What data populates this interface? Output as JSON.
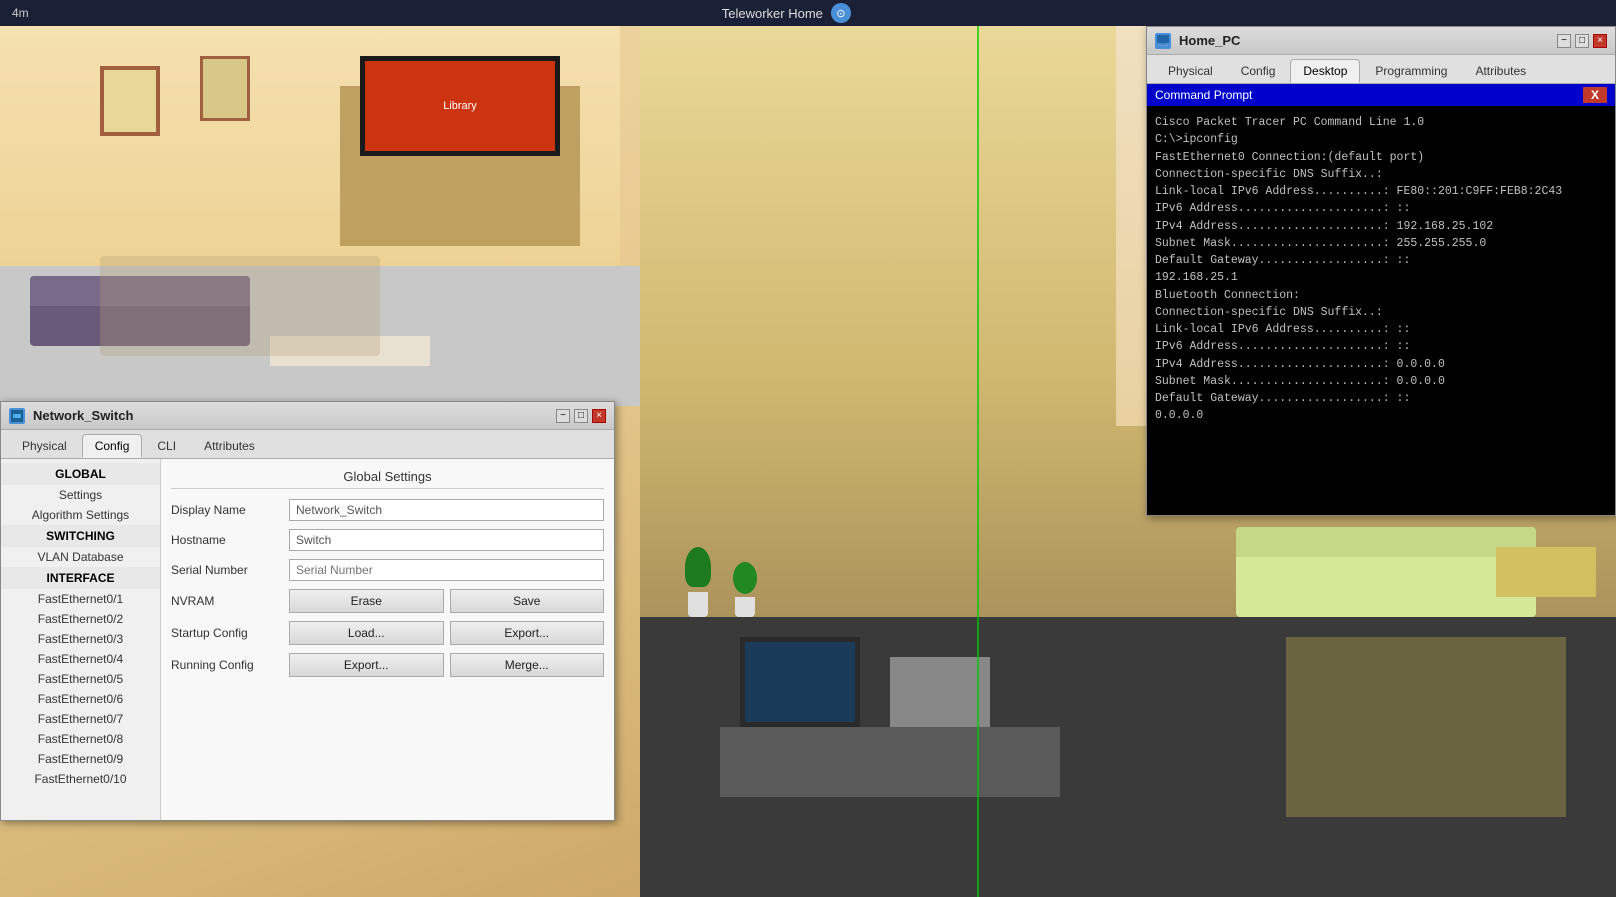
{
  "topbar": {
    "time": "4m",
    "title": "Teleworker Home",
    "icon_label": "compass"
  },
  "scene": {
    "bg_colors": [
      "#f5e6c8",
      "#e8d5a3"
    ]
  },
  "network_switch_window": {
    "title": "Network_Switch",
    "tabs": [
      {
        "label": "Physical",
        "active": false
      },
      {
        "label": "Config",
        "active": true
      },
      {
        "label": "CLI",
        "active": false
      },
      {
        "label": "Attributes",
        "active": false
      }
    ],
    "sidebar": {
      "global_header": "GLOBAL",
      "global_items": [
        "Settings",
        "Algorithm Settings"
      ],
      "switching_header": "SWITCHING",
      "switching_items": [
        "VLAN Database"
      ],
      "interface_header": "INTERFACE",
      "interface_items": [
        "FastEthernet0/1",
        "FastEthernet0/2",
        "FastEthernet0/3",
        "FastEthernet0/4",
        "FastEthernet0/5",
        "FastEthernet0/6",
        "FastEthernet0/7",
        "FastEthernet0/8",
        "FastEthernet0/9",
        "FastEthernet0/10"
      ]
    },
    "main": {
      "section_title": "Global Settings",
      "fields": {
        "display_name_label": "Display Name",
        "display_name_value": "Network_Switch",
        "hostname_label": "Hostname",
        "hostname_value": "Switch",
        "serial_number_label": "Serial Number",
        "serial_number_placeholder": "Serial Number",
        "nvram_label": "NVRAM",
        "startup_config_label": "Startup Config",
        "running_config_label": "Running Config"
      },
      "buttons": {
        "erase": "Erase",
        "save": "Save",
        "load": "Load...",
        "export_startup": "Export...",
        "export_running": "Export...",
        "merge": "Merge..."
      }
    },
    "minimize_label": "−",
    "maximize_label": "□",
    "close_label": "×"
  },
  "home_pc_window": {
    "title": "Home_PC",
    "tabs": [
      {
        "label": "Physical",
        "active": false
      },
      {
        "label": "Config",
        "active": false
      },
      {
        "label": "Desktop",
        "active": true
      },
      {
        "label": "Programming",
        "active": false
      },
      {
        "label": "Attributes",
        "active": false
      }
    ],
    "cmd": {
      "header": "Command Prompt",
      "close_btn": "X",
      "lines": [
        "Cisco Packet Tracer PC Command Line 1.0",
        "C:\\>ipconfig",
        "",
        "FastEthernet0 Connection:(default port)",
        "",
        "   Connection-specific DNS Suffix..:  ",
        "   Link-local IPv6 Address..........: FE80::201:C9FF:FEB8:2C43",
        "   IPv6 Address.....................: ::",
        "   IPv4 Address.....................: 192.168.25.102",
        "   Subnet Mask......................: 255.255.255.0",
        "   Default Gateway..................: ::",
        "                                      192.168.25.1",
        "",
        "Bluetooth Connection:",
        "",
        "   Connection-specific DNS Suffix..:  ",
        "   Link-local IPv6 Address..........: ::",
        "   IPv6 Address.....................: ::",
        "   IPv4 Address.....................: 0.0.0.0",
        "   Subnet Mask......................: 0.0.0.0",
        "   Default Gateway..................: ::",
        "                                      0.0.0.0"
      ]
    },
    "minimize_label": "−",
    "maximize_label": "□",
    "close_label": "×"
  }
}
